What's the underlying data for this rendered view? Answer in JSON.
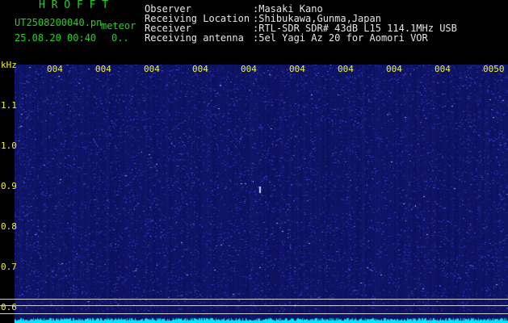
{
  "header": {
    "app_title": "H R O F F T",
    "filename": "UT2508200040.pn",
    "mode": "meteor",
    "datetime": "25.08.20 00:40",
    "count": "0..",
    "info": [
      {
        "label": "Observer",
        "value": ":Masaki Kano"
      },
      {
        "label": "Receiving Location",
        "value": ":Shibukawa,Gunma,Japan"
      },
      {
        "label": "Receiver",
        "value": ":RTL-SDR SDR# 43dB L15 114.1MHz USB"
      },
      {
        "label": "Receiving antenna",
        "value": ":5el Yagi Az 20 for Aomori VOR"
      }
    ]
  },
  "axis": {
    "unit": "kHz",
    "y_ticks": [
      "1.1",
      "1.0",
      "0.9",
      "0.8",
      "0.7",
      "0.6"
    ],
    "x_ticks": [
      "004",
      "004",
      "004",
      "004",
      "004",
      "004",
      "004",
      "004",
      "004",
      "0050"
    ]
  },
  "colors": {
    "background": "#000000",
    "spectrogram_base": "#0b0f5a",
    "noise_light": "#3c46d8",
    "label_yellow": "#f2f230",
    "title_green": "#21d321",
    "text_white": "#e6e6e6",
    "spectrum_cyan": "#00e6ff"
  }
}
